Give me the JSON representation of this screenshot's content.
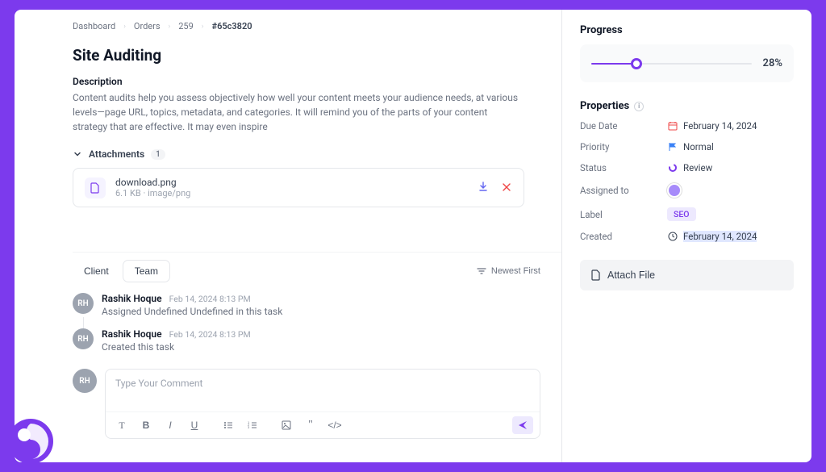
{
  "breadcrumbs": [
    "Dashboard",
    "Orders",
    "259",
    "#65c3820"
  ],
  "title": "Site Auditing",
  "description_label": "Description",
  "description_text": "Content audits help you assess objectively how well your content meets your audience needs, at various levels—page URL, topics, metadata, and categories. It will remind you of the parts of your content strategy that are effective. It may even inspire",
  "attachments": {
    "label": "Attachments",
    "count": "1",
    "file": {
      "name": "download.png",
      "meta": "6.1 KB · image/png"
    }
  },
  "tabs": {
    "client": "Client",
    "team": "Team"
  },
  "sort_label": "Newest First",
  "activity": [
    {
      "initials": "RH",
      "name": "Rashik Hoque",
      "time": "Feb 14, 2024 8:13 PM",
      "msg": "Assigned Undefined Undefined in this task"
    },
    {
      "initials": "RH",
      "name": "Rashik Hoque",
      "time": "Feb 14, 2024 8:13 PM",
      "msg": "Created this task"
    }
  ],
  "comment": {
    "initials": "RH",
    "placeholder": "Type Your Comment"
  },
  "progress": {
    "title": "Progress",
    "percent": 28,
    "percent_label": "28%"
  },
  "properties": {
    "title": "Properties",
    "due_date": {
      "label": "Due Date",
      "value": "February 14, 2024"
    },
    "priority": {
      "label": "Priority",
      "value": "Normal"
    },
    "status": {
      "label": "Status",
      "value": "Review"
    },
    "assigned": {
      "label": "Assigned to"
    },
    "labeltag": {
      "label": "Label",
      "value": "SEO"
    },
    "created": {
      "label": "Created",
      "value": "February 14, 2024"
    }
  },
  "attach_file_label": "Attach File"
}
